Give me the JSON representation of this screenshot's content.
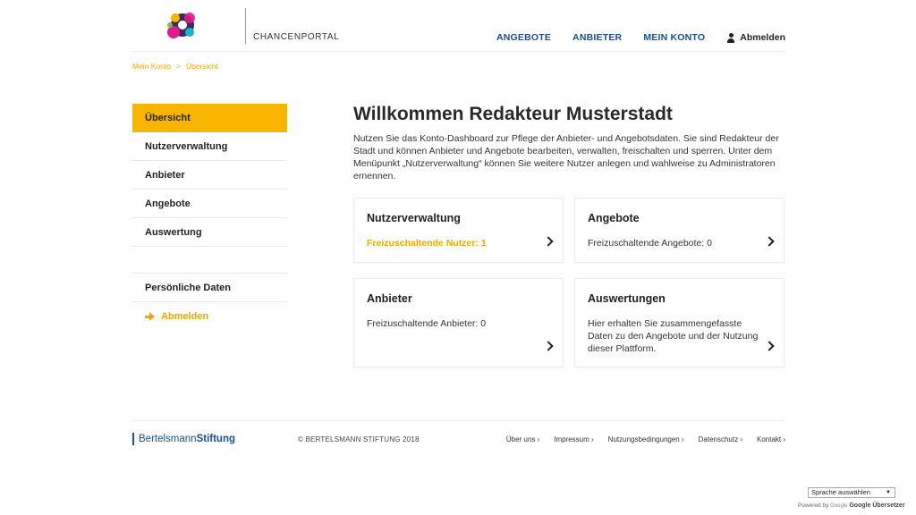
{
  "header": {
    "brand": "CHANCENPORTAL",
    "nav": [
      {
        "label": "ANGEBOTE"
      },
      {
        "label": "ANBIETER"
      },
      {
        "label": "MEIN KONTO"
      }
    ],
    "logout": "Abmelden"
  },
  "breadcrumb": {
    "items": [
      "Mein Konto",
      "Übersicht"
    ],
    "separator": ">"
  },
  "sidebar": {
    "items": [
      {
        "label": "Übersicht"
      },
      {
        "label": "Nutzerverwaltung"
      },
      {
        "label": "Anbieter"
      },
      {
        "label": "Angebote"
      },
      {
        "label": "Auswertung"
      }
    ],
    "personal": "Persönliche Daten",
    "logout": "Abmelden"
  },
  "main": {
    "title": "Willkommen Redakteur Musterstadt",
    "intro": "Nutzen Sie das Konto-Dashboard zur Pflege der Anbieter- und Angebotsdaten. Sie sind Redakteur der Stadt und können Anbieter und Angebote bearbeiten, verwalten, freischalten und sperren. Unter dem Menüpunkt „Nutzerverwaltung“ können Sie weitere Nutzer anlegen und wahlweise zu Administratoren ernennen.",
    "cards": [
      {
        "title": "Nutzerverwaltung",
        "text": "Freizuschaltende Nutzer: 1"
      },
      {
        "title": "Angebote",
        "text": "Freizuschaltende Angebote: 0"
      },
      {
        "title": "Anbieter",
        "text": "Freizuschaltende Anbieter: 0"
      },
      {
        "title": "Auswertungen",
        "text": "Hier erhalten Sie zusammengefasste Daten zu den Angebote und der Nutzung dieser Plattform."
      }
    ]
  },
  "footer": {
    "logo_part1": "Bertelsmann",
    "logo_part2": "Stiftung",
    "copyright": "© BERTELSMANN STIFTUNG 2018",
    "links": [
      "Über uns ›",
      "Impressum ›",
      "Nutzungsbedingungen ›",
      "Datenschutz ›",
      "Kontakt ›"
    ]
  },
  "translate": {
    "select_value": "Sprache auswählen",
    "powered_by": "Powered by",
    "google": "Google",
    "service": "Google Übersetzer"
  },
  "colors": {
    "accent": "#f7b500",
    "accent_text": "#f0a500",
    "nav_blue": "#1a4f8a"
  }
}
